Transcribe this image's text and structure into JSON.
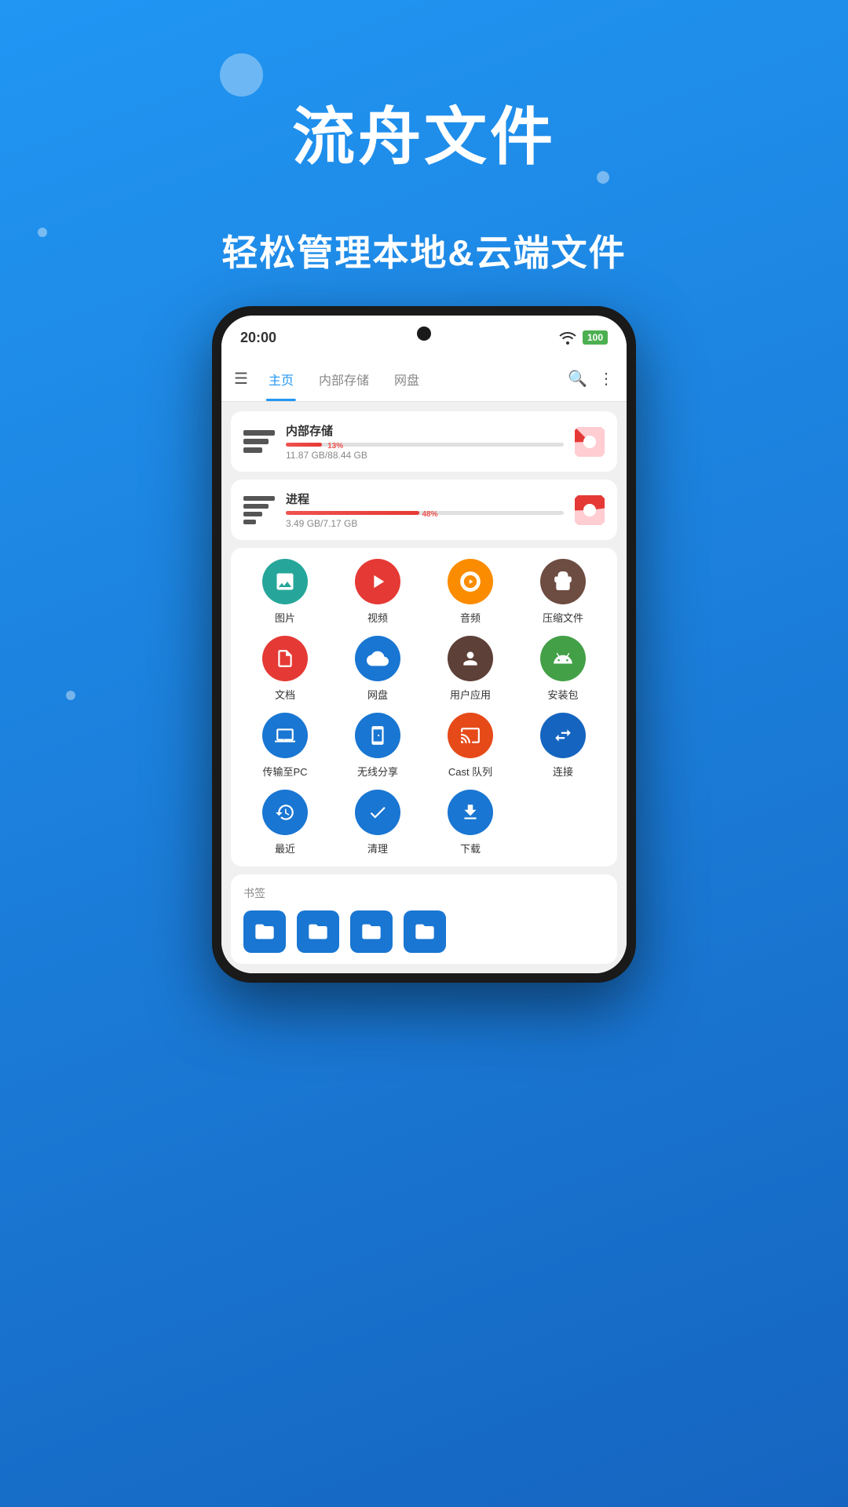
{
  "app": {
    "title": "流舟文件",
    "subtitle": "轻松管理本地&云端文件"
  },
  "phone": {
    "status_bar": {
      "time": "20:00",
      "battery": "100"
    },
    "nav": {
      "tabs": [
        {
          "label": "主页",
          "active": true
        },
        {
          "label": "内部存储",
          "active": false
        },
        {
          "label": "网盘",
          "active": false
        }
      ]
    },
    "storage": [
      {
        "title": "内部存储",
        "progress": 13,
        "progress_label": "13%",
        "size": "11.87 GB/88.44 GB"
      },
      {
        "title": "进程",
        "progress": 48,
        "progress_label": "48%",
        "size": "3.49 GB/7.17 GB"
      }
    ],
    "categories": [
      {
        "label": "图片",
        "color": "#26A69A",
        "icon": "🖼"
      },
      {
        "label": "视频",
        "color": "#E53935",
        "icon": "▶"
      },
      {
        "label": "音频",
        "color": "#FB8C00",
        "icon": "🎧"
      },
      {
        "label": "压缩文件",
        "color": "#6D4C41",
        "icon": "📦"
      },
      {
        "label": "文档",
        "color": "#E53935",
        "icon": "📄"
      },
      {
        "label": "网盘",
        "color": "#1976D2",
        "icon": "☁"
      },
      {
        "label": "用户应用",
        "color": "#5D4037",
        "icon": "👤"
      },
      {
        "label": "安装包",
        "color": "#43A047",
        "icon": "🤖"
      },
      {
        "label": "传输至PC",
        "color": "#1976D2",
        "icon": "💻"
      },
      {
        "label": "无线分享",
        "color": "#1976D2",
        "icon": "📲"
      },
      {
        "label": "Cast 队列",
        "color": "#E64A19",
        "icon": "📡"
      },
      {
        "label": "连接",
        "color": "#1565C0",
        "icon": "↔"
      },
      {
        "label": "最近",
        "color": "#1976D2",
        "icon": "🕐"
      },
      {
        "label": "清理",
        "color": "#1976D2",
        "icon": "✔"
      },
      {
        "label": "下载",
        "color": "#1976D2",
        "icon": "⬇"
      }
    ],
    "bookmarks": {
      "title": "书签",
      "items": [
        "📁",
        "📁",
        "📁",
        "📁"
      ]
    }
  }
}
